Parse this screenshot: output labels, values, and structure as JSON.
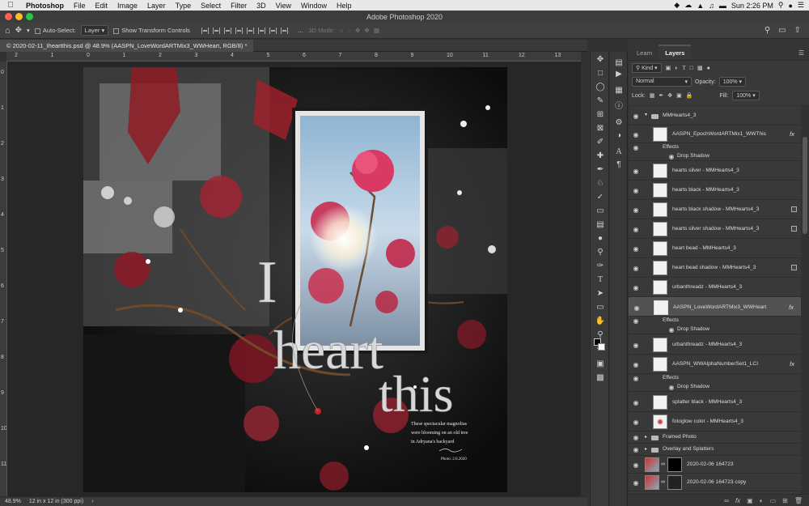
{
  "menubar": {
    "items": [
      "Photoshop",
      "File",
      "Edit",
      "Image",
      "Layer",
      "Type",
      "Select",
      "Filter",
      "3D",
      "View",
      "Window",
      "Help"
    ],
    "clock": "Sun 2:26 PM"
  },
  "window": {
    "title": "Adobe Photoshop 2020"
  },
  "options": {
    "auto_select_label": "Auto-Select:",
    "auto_select_target": "Layer",
    "show_transform_label": "Show Transform Controls",
    "mode_3d_label": "3D Mode:"
  },
  "document": {
    "tab_title": "© 2020-02-11_Iheartthis.psd @ 48.9% (AASPN_LoveWordARTMix3_WWHeart, RGB/8) *"
  },
  "rulers": {
    "h": [
      "2",
      "1",
      "0",
      "1",
      "2",
      "3",
      "4",
      "5",
      "6",
      "7",
      "8",
      "9",
      "10",
      "11",
      "12",
      "13"
    ],
    "v": [
      "0",
      "1",
      "2",
      "3",
      "4",
      "5",
      "6",
      "7",
      "8",
      "9",
      "10",
      "11"
    ]
  },
  "artwork": {
    "word1": "I",
    "word2": "heart",
    "word3": "this",
    "caption1": "These spectacular magnolias",
    "caption2": "were blooming on an old tree",
    "caption3": "in Adryana's backyard",
    "signature": "Photo: 2.6.2020"
  },
  "status": {
    "zoom": "48.9%",
    "doc_info": "12 in x 12 in (300 ppi)"
  },
  "panel": {
    "tabs": [
      "Learn",
      "Layers"
    ],
    "kind_label": "Kind",
    "blend_mode": "Normal",
    "opacity_label": "Opacity:",
    "opacity_value": "100%",
    "lock_label": "Lock:",
    "fill_label": "Fill:",
    "fill_value": "100%",
    "layers": [
      {
        "name": "MMHearts4_3",
        "type": "group"
      },
      {
        "name": "AASPN_EpochWordARTMix1_WWThis",
        "type": "layer",
        "fx": "fx"
      },
      {
        "name": "Effects",
        "type": "effects"
      },
      {
        "name": "Drop Shadow",
        "type": "effect"
      },
      {
        "name": "hearts silver - MMHearts4_3",
        "type": "layer"
      },
      {
        "name": "hearts black - MMHearts4_3",
        "type": "layer"
      },
      {
        "name": "hearts black shadow - MMHearts4_3",
        "type": "layer",
        "badge": true
      },
      {
        "name": "hearts silver shadow - MMHearts4_3",
        "type": "layer",
        "badge": true
      },
      {
        "name": "heart bead - MMHearts4_3",
        "type": "layer"
      },
      {
        "name": "heart bead shadow - MMHearts4_3",
        "type": "layer",
        "badge": true
      },
      {
        "name": "urbanthreadz - MMHearts4_3",
        "type": "layer"
      },
      {
        "name": "AASPN_LoveWordARTMix3_WWHeart",
        "type": "layer",
        "fx": "fx",
        "selected": true
      },
      {
        "name": "Effects",
        "type": "effects"
      },
      {
        "name": "Drop Shadow",
        "type": "effect"
      },
      {
        "name": "urbanthreadz - MMHearts4_3",
        "type": "layer"
      },
      {
        "name": "AASPN_WWAlphaNumberSet1_LCI",
        "type": "layer",
        "fx": "fx"
      },
      {
        "name": "Effects",
        "type": "effects"
      },
      {
        "name": "Drop Shadow",
        "type": "effect"
      },
      {
        "name": "splatter black - MMHearts4_3",
        "type": "layer"
      },
      {
        "name": "fotoglow color - MMHearts4_3",
        "type": "layer"
      },
      {
        "name": "Framed Photo",
        "type": "group"
      },
      {
        "name": "Overlay and Splatters",
        "type": "group"
      },
      {
        "name": "2020-02-06 164723",
        "type": "photo"
      },
      {
        "name": "2020-02-06 164723 copy",
        "type": "photo"
      }
    ]
  },
  "colors": {
    "accent": "#525252",
    "traffic_red": "#ff5f57",
    "traffic_yellow": "#febc2e",
    "traffic_green": "#28c840"
  }
}
